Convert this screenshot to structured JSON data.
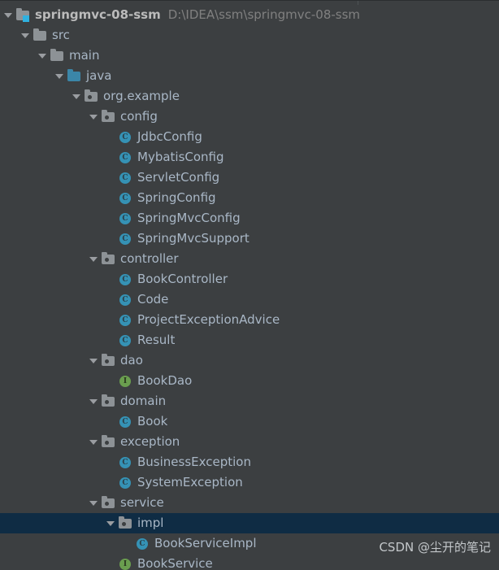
{
  "window": {
    "name": "project-tool-window",
    "background": "#3c3f41",
    "selection_color": "#0f2c44",
    "text_color": "#a9b7c6",
    "dim_text_color": "#808080"
  },
  "tree": {
    "rows": [
      {
        "depth": 0,
        "arrow": "expanded",
        "icon": "module-icon",
        "label": "springmvc-08-ssm",
        "bold": true,
        "path": "D:\\IDEA\\ssm\\springmvc-08-ssm",
        "selected": false
      },
      {
        "depth": 1,
        "arrow": "expanded",
        "icon": "folder-icon",
        "label": "src",
        "bold": false,
        "path": "",
        "selected": false
      },
      {
        "depth": 2,
        "arrow": "expanded",
        "icon": "folder-icon",
        "label": "main",
        "bold": false,
        "path": "",
        "selected": false
      },
      {
        "depth": 3,
        "arrow": "expanded",
        "icon": "source-folder-icon",
        "label": "java",
        "bold": false,
        "path": "",
        "selected": false
      },
      {
        "depth": 4,
        "arrow": "expanded",
        "icon": "package-icon",
        "label": "org.example",
        "bold": false,
        "path": "",
        "selected": false
      },
      {
        "depth": 5,
        "arrow": "expanded",
        "icon": "package-icon",
        "label": "config",
        "bold": false,
        "path": "",
        "selected": false
      },
      {
        "depth": 6,
        "arrow": "none",
        "icon": "class-icon",
        "label": "JdbcConfig",
        "bold": false,
        "path": "",
        "selected": false
      },
      {
        "depth": 6,
        "arrow": "none",
        "icon": "class-icon",
        "label": "MybatisConfig",
        "bold": false,
        "path": "",
        "selected": false
      },
      {
        "depth": 6,
        "arrow": "none",
        "icon": "class-icon",
        "label": "ServletConfig",
        "bold": false,
        "path": "",
        "selected": false
      },
      {
        "depth": 6,
        "arrow": "none",
        "icon": "class-icon",
        "label": "SpringConfig",
        "bold": false,
        "path": "",
        "selected": false
      },
      {
        "depth": 6,
        "arrow": "none",
        "icon": "class-icon",
        "label": "SpringMvcConfig",
        "bold": false,
        "path": "",
        "selected": false
      },
      {
        "depth": 6,
        "arrow": "none",
        "icon": "class-icon",
        "label": "SpringMvcSupport",
        "bold": false,
        "path": "",
        "selected": false
      },
      {
        "depth": 5,
        "arrow": "expanded",
        "icon": "package-icon",
        "label": "controller",
        "bold": false,
        "path": "",
        "selected": false
      },
      {
        "depth": 6,
        "arrow": "none",
        "icon": "class-icon",
        "label": "BookController",
        "bold": false,
        "path": "",
        "selected": false
      },
      {
        "depth": 6,
        "arrow": "none",
        "icon": "class-icon",
        "label": "Code",
        "bold": false,
        "path": "",
        "selected": false
      },
      {
        "depth": 6,
        "arrow": "none",
        "icon": "class-icon",
        "label": "ProjectExceptionAdvice",
        "bold": false,
        "path": "",
        "selected": false
      },
      {
        "depth": 6,
        "arrow": "none",
        "icon": "class-icon",
        "label": "Result",
        "bold": false,
        "path": "",
        "selected": false
      },
      {
        "depth": 5,
        "arrow": "expanded",
        "icon": "package-icon",
        "label": "dao",
        "bold": false,
        "path": "",
        "selected": false
      },
      {
        "depth": 6,
        "arrow": "none",
        "icon": "interface-icon",
        "label": "BookDao",
        "bold": false,
        "path": "",
        "selected": false
      },
      {
        "depth": 5,
        "arrow": "expanded",
        "icon": "package-icon",
        "label": "domain",
        "bold": false,
        "path": "",
        "selected": false
      },
      {
        "depth": 6,
        "arrow": "none",
        "icon": "class-icon",
        "label": "Book",
        "bold": false,
        "path": "",
        "selected": false
      },
      {
        "depth": 5,
        "arrow": "expanded",
        "icon": "package-icon",
        "label": "exception",
        "bold": false,
        "path": "",
        "selected": false
      },
      {
        "depth": 6,
        "arrow": "none",
        "icon": "class-icon",
        "label": "BusinessException",
        "bold": false,
        "path": "",
        "selected": false
      },
      {
        "depth": 6,
        "arrow": "none",
        "icon": "class-icon",
        "label": "SystemException",
        "bold": false,
        "path": "",
        "selected": false
      },
      {
        "depth": 5,
        "arrow": "expanded",
        "icon": "package-icon",
        "label": "service",
        "bold": false,
        "path": "",
        "selected": false
      },
      {
        "depth": 6,
        "arrow": "expanded",
        "icon": "package-icon",
        "label": "impl",
        "bold": false,
        "path": "",
        "selected": true
      },
      {
        "depth": 7,
        "arrow": "none",
        "icon": "class-icon",
        "label": "BookServiceImpl",
        "bold": false,
        "path": "",
        "selected": false
      },
      {
        "depth": 6,
        "arrow": "none",
        "icon": "interface-icon",
        "label": "BookService",
        "bold": false,
        "path": "",
        "selected": false
      }
    ]
  },
  "watermark": {
    "text": "CSDN @尘开的笔记"
  },
  "icon_glyphs": {
    "class": "C",
    "interface": "I"
  }
}
